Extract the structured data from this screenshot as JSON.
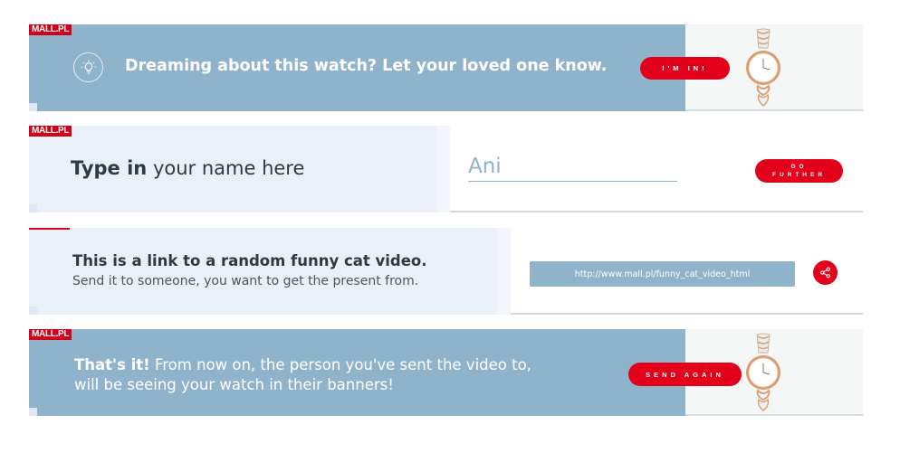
{
  "brand": {
    "logo_text": "MALL.PL"
  },
  "colors": {
    "blue": "#8fb3cb",
    "light": "#eaf0f7",
    "red": "#e2001a"
  },
  "banner1": {
    "icon": "lightbulb-icon",
    "message": "Dreaming about this watch? Let your loved one know.",
    "button_label": "I'M IN!"
  },
  "banner2": {
    "prompt_bold": "Type in",
    "prompt_rest": " your name here",
    "input_value": "Ani",
    "button_line1": "GO",
    "button_line2": "FURTHER"
  },
  "banner3": {
    "title": "This is a link to a random funny cat video.",
    "subtitle": "Send it to someone, you want to get the present from.",
    "url": "http://www.mall.pl/funny_cat_video_html",
    "share_icon": "share-icon"
  },
  "banner4": {
    "lead_bold": "That's it!",
    "lead_rest": " From now on, the person you've sent the video to,",
    "line2": "will be seeing your watch in their banners!",
    "button_label": "SEND AGAIN"
  }
}
